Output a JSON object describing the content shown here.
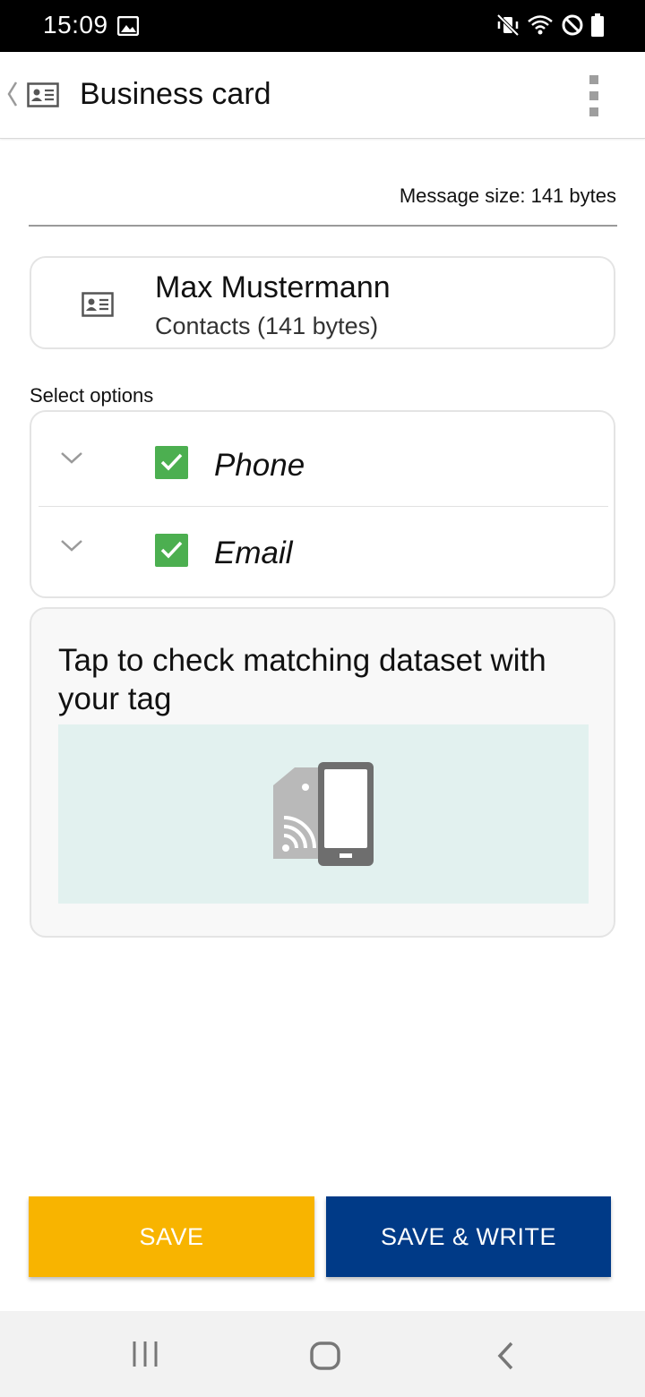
{
  "status_bar": {
    "time": "15:09",
    "icons": [
      "gallery-icon",
      "mute-vibrate-icon",
      "wifi-icon",
      "do-not-disturb-icon",
      "battery-icon"
    ]
  },
  "app_bar": {
    "title": "Business card",
    "icons": [
      "back-chevron-icon",
      "business-card-icon",
      "more-options-icon"
    ]
  },
  "message_size": "Message size: 141 bytes",
  "contact": {
    "name": "Max Mustermann",
    "subtitle": "Contacts (141 bytes)"
  },
  "select_options_label": "Select options",
  "options": [
    {
      "label": "Phone",
      "checked": true
    },
    {
      "label": "Email",
      "checked": true
    }
  ],
  "tap_card": {
    "text": "Tap to check matching dataset with your tag"
  },
  "buttons": {
    "save": "SAVE",
    "save_write": "SAVE & WRITE"
  },
  "colors": {
    "save": "#f8b400",
    "save_write": "#003a87",
    "checkbox": "#4caf50",
    "illustration_bg": "#e2f1ef"
  }
}
